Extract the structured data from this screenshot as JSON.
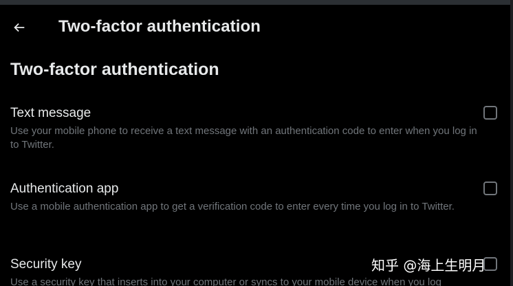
{
  "header": {
    "back_icon": "arrow-left-icon",
    "title": "Two-factor authentication"
  },
  "section": {
    "title": "Two-factor authentication"
  },
  "options": [
    {
      "label": "Text message",
      "description": "Use your mobile phone to receive a text message with an authentication code to enter when you log in to Twitter.",
      "checked": false
    },
    {
      "label": "Authentication app",
      "description": "Use a mobile authentication app to get a verification code to enter every time you log in to Twitter.",
      "checked": false
    },
    {
      "label": "Security key",
      "description": "Use a security key that inserts into your computer or syncs to your mobile device when you log",
      "checked": false
    }
  ],
  "watermark": {
    "text": "知乎 @海上生明月"
  },
  "colors": {
    "background": "#000000",
    "text_primary": "#e7e9ea",
    "text_secondary": "#71767b"
  }
}
